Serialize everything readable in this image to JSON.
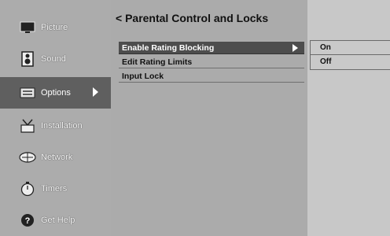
{
  "sidebar": {
    "items": [
      {
        "label": "Picture",
        "icon": "picture-icon"
      },
      {
        "label": "Sound",
        "icon": "speaker-icon"
      },
      {
        "label": "Options",
        "icon": "options-icon",
        "active": true
      },
      {
        "label": "Installation",
        "icon": "antenna-icon"
      },
      {
        "label": "Network",
        "icon": "network-icon"
      },
      {
        "label": "Timers",
        "icon": "stopwatch-icon"
      },
      {
        "label": "Get Help",
        "icon": "help-icon"
      }
    ]
  },
  "panel": {
    "title": "< Parental Control and Locks",
    "items": [
      {
        "label": "Enable Rating Blocking",
        "selected": true
      },
      {
        "label": "Edit Rating Limits"
      },
      {
        "label": "Input Lock"
      }
    ]
  },
  "submenu": {
    "options": [
      "On",
      "Off"
    ]
  }
}
